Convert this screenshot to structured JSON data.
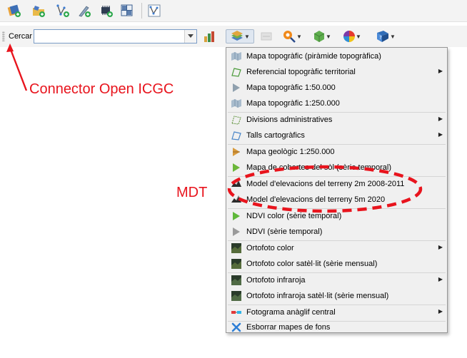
{
  "toolbar_top": {
    "icons": [
      "layers-add-icon",
      "folder-add-icon",
      "vector-add-icon",
      "pen-add-icon",
      "chip-add-icon",
      "grid-add-icon",
      "vector-edit-icon"
    ]
  },
  "search": {
    "label": "Cercar",
    "value": ""
  },
  "menu": {
    "items": [
      {
        "label": "Mapa topogràfic (piràmide topogràfica)"
      },
      {
        "label": "Referencial topogràfic territorial"
      },
      {
        "label": "Mapa topogràfic 1:50.000"
      },
      {
        "label": "Mapa topogràfic 1:250.000"
      },
      {
        "label": "Divisions administratives"
      },
      {
        "label": "Talls cartogràfics"
      },
      {
        "label": "Mapa geològic 1:250.000"
      },
      {
        "label": "Mapa de cobertes del sòl (sèrie temporal)"
      },
      {
        "label": "Model d'elevacions del terreny 2m 2008-2011"
      },
      {
        "label": "Model d'elevacions del terreny 5m 2020"
      },
      {
        "label": "NDVI color (sèrie temporal)"
      },
      {
        "label": "NDVI (sèrie temporal)"
      },
      {
        "label": "Ortofoto color"
      },
      {
        "label": "Ortofoto color satèl·lit (sèrie mensual)"
      },
      {
        "label": "Ortofoto infraroja"
      },
      {
        "label": "Ortofoto infraroja satèl·lit (sèrie mensual)"
      },
      {
        "label": "Fotograma anàglif central"
      },
      {
        "label": "Esborrar mapes de fons"
      }
    ]
  },
  "annotations": {
    "connector_label": "Connector Open ICGC",
    "mdt_label": "MDT",
    "color": "#e8141d"
  }
}
